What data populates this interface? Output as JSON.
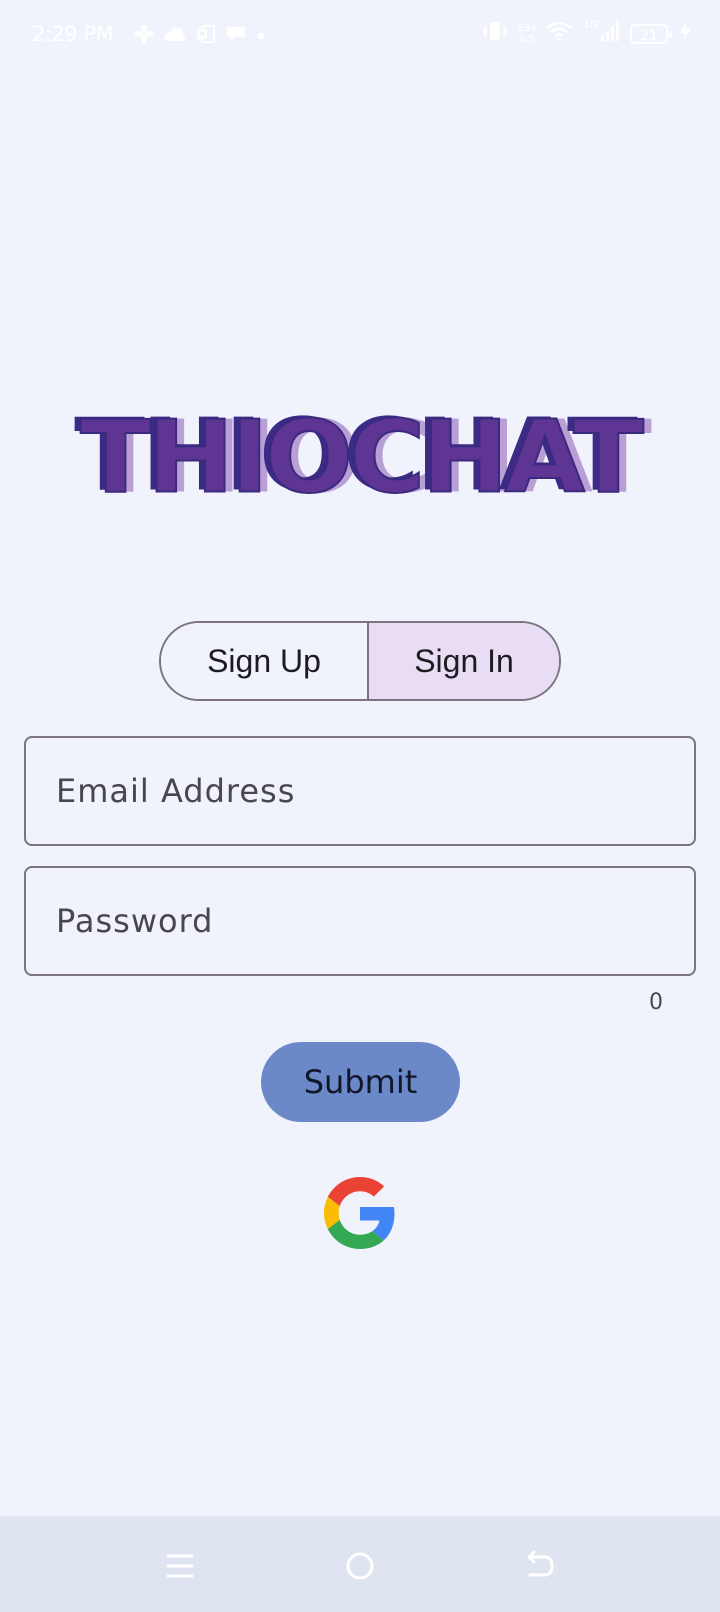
{
  "status_bar": {
    "time": "2:29 PM",
    "left_icons": [
      "fan-icon",
      "cloud-icon",
      "outlook-icon",
      "chat-bubble-icon",
      "dot-icon"
    ],
    "speed_top": "834",
    "speed_bottom": "B/S",
    "network_label": "4G",
    "battery": "21"
  },
  "app": {
    "logo": "THIOCHAT",
    "tabs": [
      {
        "label": "Sign Up",
        "selected": false
      },
      {
        "label": "Sign In",
        "selected": true
      }
    ]
  },
  "form": {
    "email_placeholder": "Email Address",
    "email_value": "",
    "password_placeholder": "Password",
    "password_value": "",
    "password_counter": "0",
    "submit_label": "Submit",
    "google_icon": "google-icon"
  },
  "nav_bar": {
    "buttons": [
      "menu-icon",
      "home-icon",
      "back-icon"
    ]
  },
  "colors": {
    "background": "#f0f3fb",
    "tab_selected": "#e8ddf5",
    "submit": "#6b88c9",
    "logo": "#5e3592",
    "nav_bar": "#dfe4f1"
  }
}
